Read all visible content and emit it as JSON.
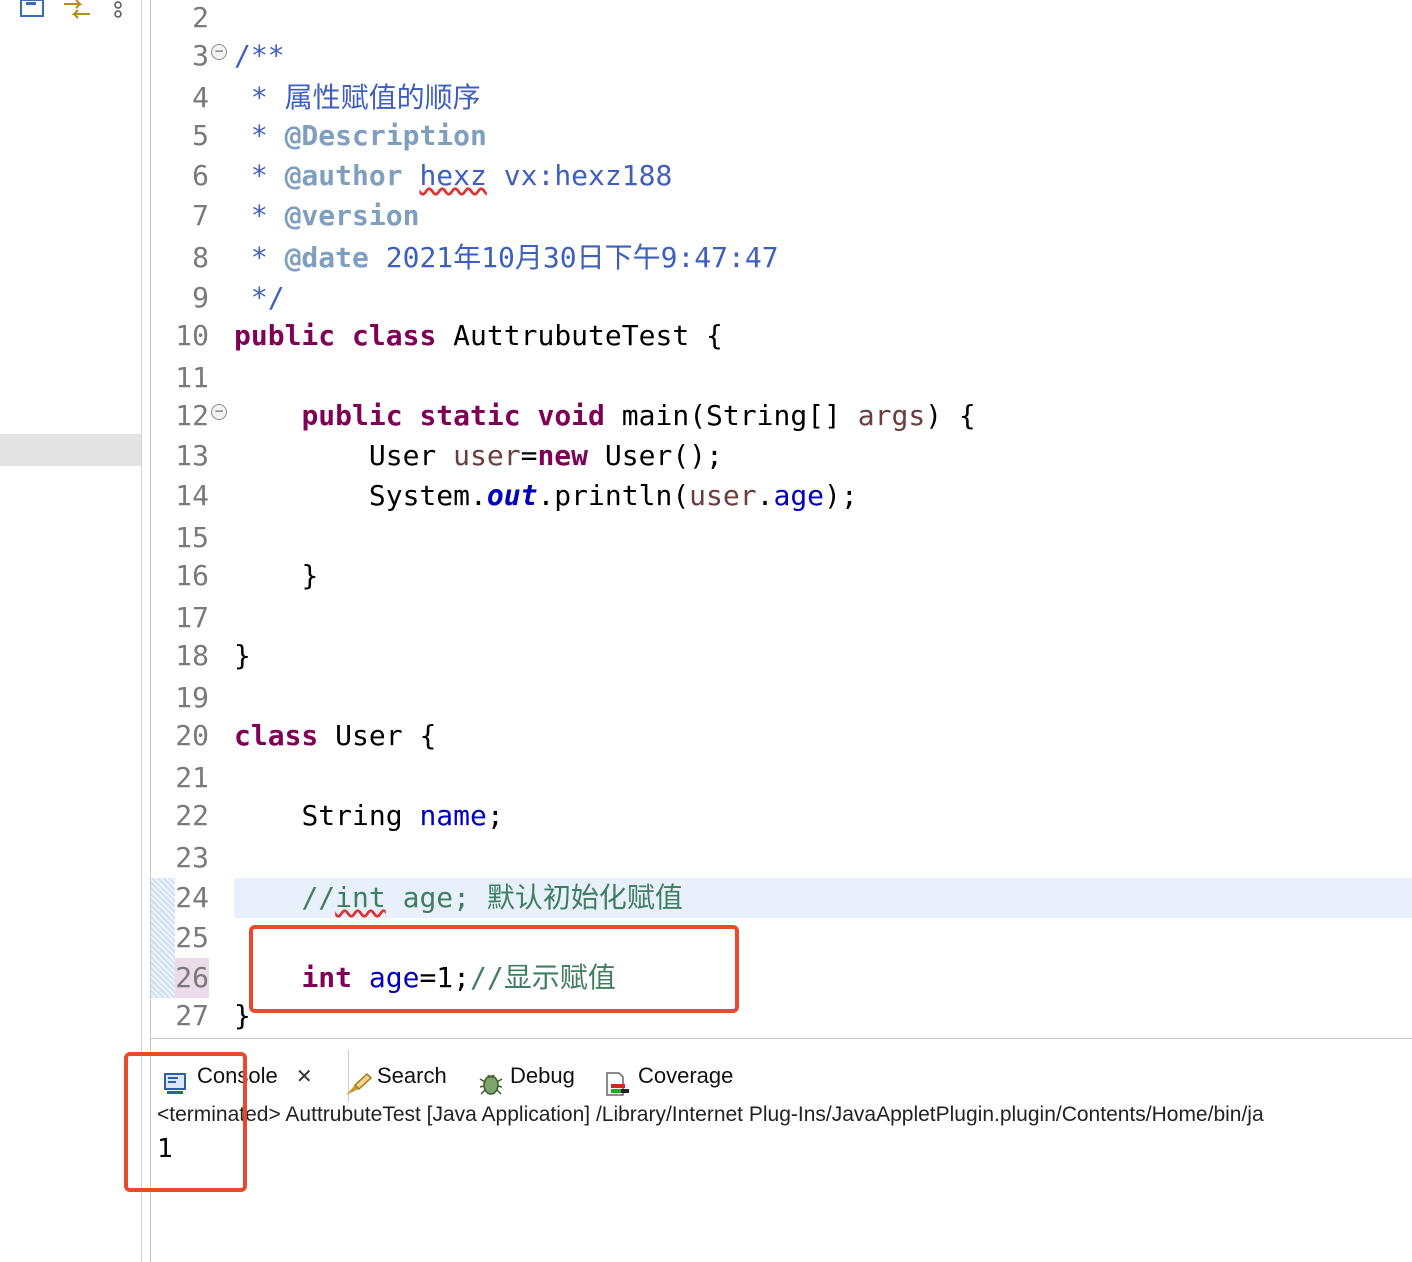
{
  "toolbar": {
    "icons": [
      "outline-icon",
      "link-editor-icon",
      "more-options-icon"
    ]
  },
  "editor": {
    "lines": [
      {
        "n": "2"
      },
      {
        "n": "3"
      },
      {
        "n": "4"
      },
      {
        "n": "5"
      },
      {
        "n": "6"
      },
      {
        "n": "7"
      },
      {
        "n": "8"
      },
      {
        "n": "9"
      },
      {
        "n": "10"
      },
      {
        "n": "11"
      },
      {
        "n": "12"
      },
      {
        "n": "13"
      },
      {
        "n": "14"
      },
      {
        "n": "15"
      },
      {
        "n": "16"
      },
      {
        "n": "17"
      },
      {
        "n": "18"
      },
      {
        "n": "19"
      },
      {
        "n": "20"
      },
      {
        "n": "21"
      },
      {
        "n": "22"
      },
      {
        "n": "23"
      },
      {
        "n": "24"
      },
      {
        "n": "25"
      },
      {
        "n": "26"
      },
      {
        "n": "27"
      }
    ],
    "code": {
      "l3": "/**",
      "l4_star": " * ",
      "l4_text": "属性赋值的顺序",
      "l5_tag": "@Description",
      "l6_tag": "@author",
      "l6_name": "hexz",
      "l6_rest": " vx:hexz188",
      "l7_tag": "@version",
      "l8_tag": "@date",
      "l8_rest": " 2021年10月30日下午9:47:47",
      "l9": " */",
      "kw_public": "public",
      "kw_class": "class",
      "l10_name": " AuttrubuteTest {",
      "kw_static": "static",
      "kw_void": "void",
      "l12_main": " main(String[] ",
      "l12_args": "args",
      "l12_end": ") {",
      "l13_type": "User ",
      "l13_var": "user",
      "l13_eq": "=",
      "kw_new": "new",
      "l13_end": " User();",
      "l14_sys": "System.",
      "l14_out": "out",
      "l14_println": ".println(",
      "l14_user": "user",
      "l14_dot": ".",
      "l14_age": "age",
      "l14_end": ");",
      "l16": "}",
      "l18": "}",
      "l20_name": " User {",
      "l22_type": "String ",
      "l22_name": "name",
      "l22_end": ";",
      "l24_slashes": "//",
      "l24_int": "int",
      "l24_rest": " age; 默认初始化赋值",
      "kw_int": "int",
      "l26_age": "age",
      "l26_val": "=1;",
      "l26_comment": "//显示赋值",
      "l27": "}"
    }
  },
  "console": {
    "tabs": [
      {
        "label": "Console",
        "icon": "console-icon",
        "active": true
      },
      {
        "label": "Search",
        "icon": "search-icon",
        "active": false
      },
      {
        "label": "Debug",
        "icon": "debug-icon",
        "active": false
      },
      {
        "label": "Coverage",
        "icon": "coverage-icon",
        "active": false
      }
    ],
    "close_glyph": "✕",
    "terminated": "<terminated> AuttrubuteTest [Java Application] /Library/Internet Plug-Ins/JavaAppletPlugin.plugin/Contents/Home/bin/ja",
    "output": "1"
  },
  "colors": {
    "highlight_box": "#e84a2c",
    "keyword": "#7f0055",
    "comment": "#3f7f5f",
    "javadoc": "#3f5fbf",
    "field": "#0000c0"
  }
}
